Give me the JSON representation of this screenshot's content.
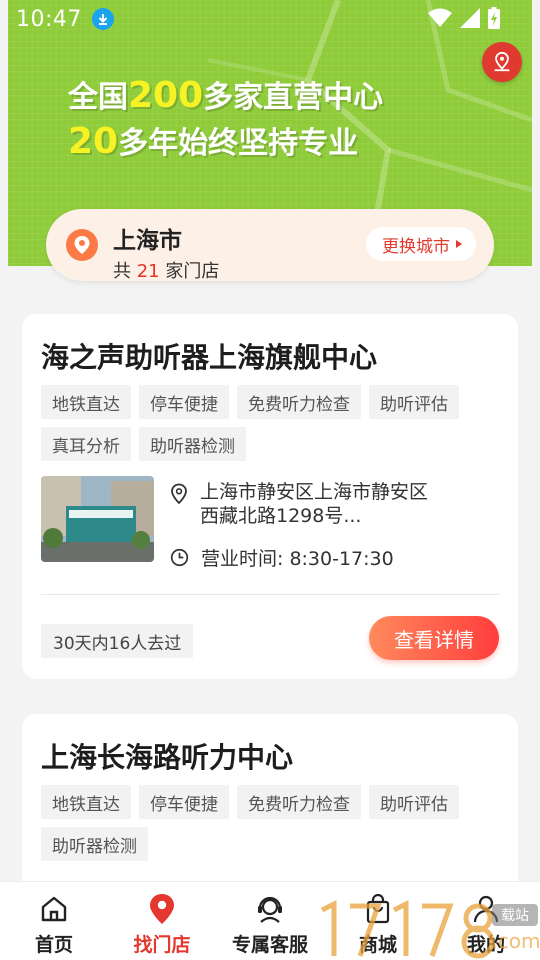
{
  "status_bar": {
    "time": "10:47"
  },
  "banner": {
    "line1_pre": "全国",
    "line1_hl": "200",
    "line1_post": "多家直营中心",
    "line2_hl": "20",
    "line2_post": "多年始终坚持专业"
  },
  "city": {
    "name": "上海市",
    "count_pre": "共",
    "count_num": "21",
    "count_post": "家门店",
    "change_label": "更换城市"
  },
  "stores": [
    {
      "title": "海之声助听器上海旗舰中心",
      "tags": [
        "地铁直达",
        "停车便捷",
        "免费听力检查",
        "助听评估",
        "真耳分析",
        "助听器检测"
      ],
      "address": "上海市静安区上海市静安区西藏北路1298号...",
      "hours": "营业时间: 8:30-17:30",
      "visits": "30天内16人去过",
      "detail_label": "查看详情"
    },
    {
      "title": "上海长海路听力中心",
      "tags": [
        "地铁直达",
        "停车便捷",
        "免费听力检查",
        "助听评估",
        "助听器检测"
      ]
    }
  ],
  "nav": {
    "items": [
      {
        "label": "首页",
        "icon": "home-icon"
      },
      {
        "label": "找门店",
        "icon": "location-pin-icon"
      },
      {
        "label": "专属客服",
        "icon": "headset-icon"
      },
      {
        "label": "商城",
        "icon": "shopping-bag-icon"
      },
      {
        "label": "我的",
        "icon": "user-icon"
      }
    ]
  },
  "colors": {
    "banner": "#8fcc3a",
    "accent": "#e4372e",
    "highlight": "#f7f224"
  }
}
